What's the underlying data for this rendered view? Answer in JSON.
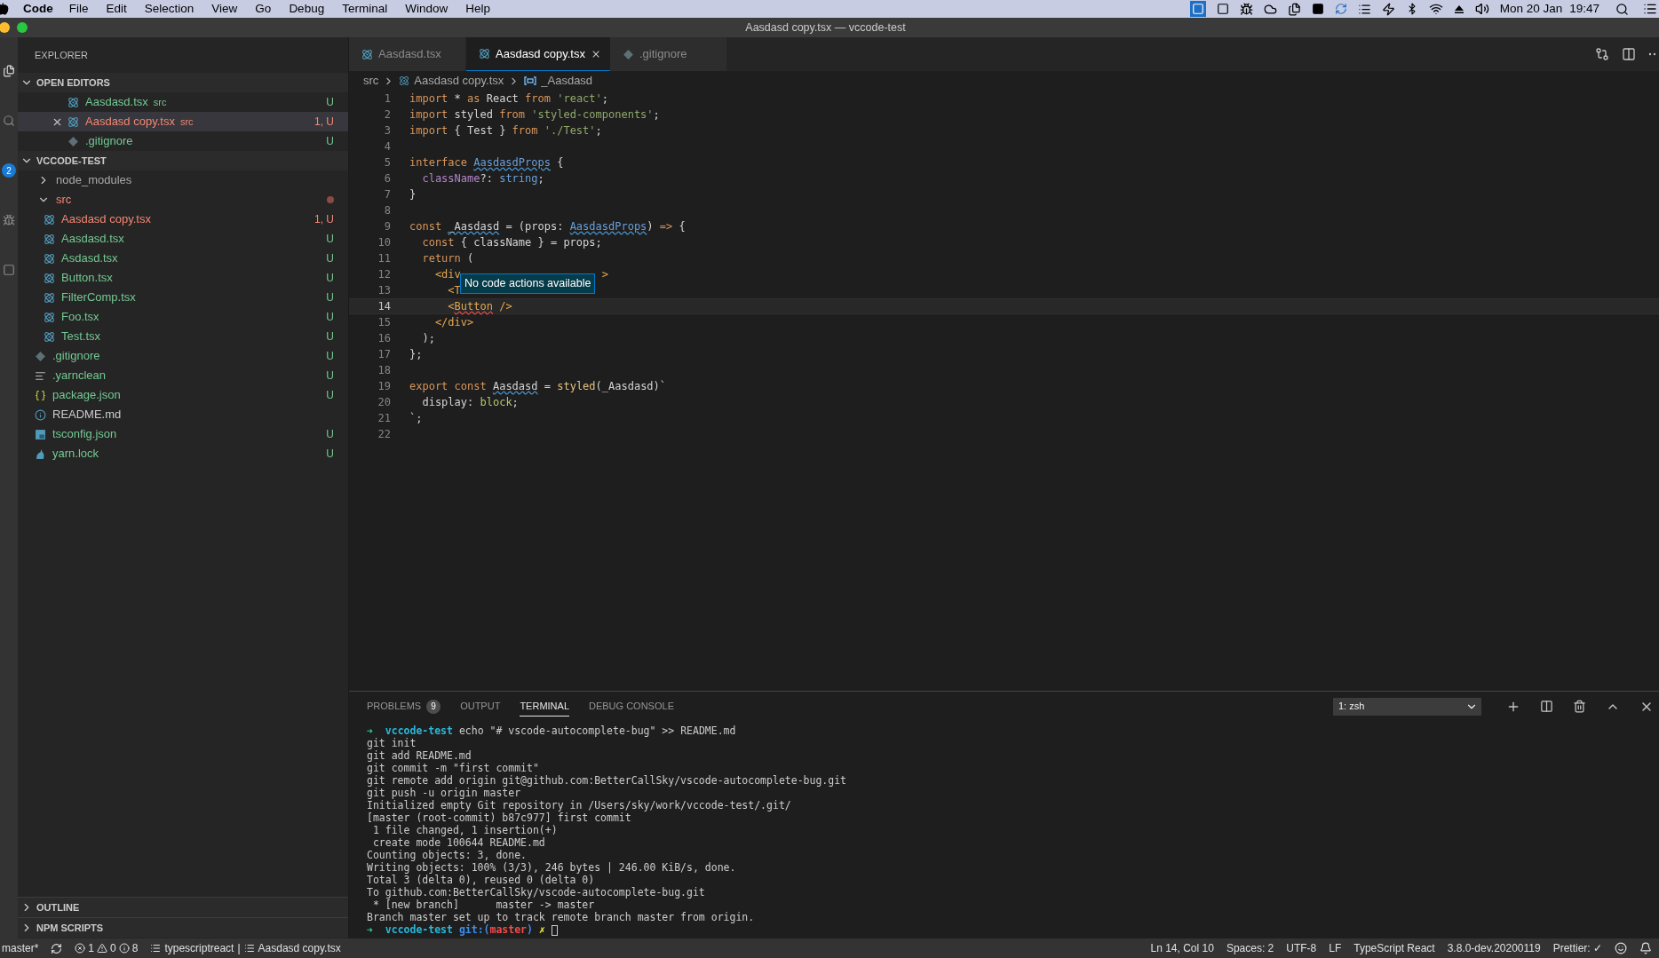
{
  "menu_bar": {
    "app": "Code",
    "menus": [
      "File",
      "Edit",
      "Selection",
      "View",
      "Go",
      "Debug",
      "Terminal",
      "Window",
      "Help"
    ],
    "date": "Mon 20 Jan",
    "time": "19:47"
  },
  "window": {
    "title": "Aasdasd copy.tsx — vccode-test"
  },
  "activity_bar": {
    "badge": "2"
  },
  "sidebar": {
    "title": "EXPLORER",
    "open_editors": {
      "label": "OPEN EDITORS",
      "expanded": true,
      "items": [
        {
          "name": "Aasdasd.tsx",
          "folder": "src",
          "kind": "react",
          "color": "#73c991",
          "badge": "U",
          "selected": false
        },
        {
          "name": "Aasdasd copy.tsx",
          "folder": "src",
          "kind": "react",
          "color": "#f48771",
          "badge": "1, U",
          "selected": true
        },
        {
          "name": ".gitignore",
          "kind": "git",
          "color": "#73c991",
          "badge": "U",
          "selected": false
        }
      ]
    },
    "project": {
      "label": "VCCODE-TEST",
      "expanded": true,
      "items": [
        {
          "name": "node_modules",
          "kind": "folder",
          "color": "#a8a8a8",
          "expanded": false
        },
        {
          "name": "src",
          "kind": "folder",
          "color": "#f48771",
          "expanded": true,
          "children": [
            {
              "name": "Aasdasd copy.tsx",
              "kind": "react",
              "color": "#f48771",
              "badge": "1, U"
            },
            {
              "name": "Aasdasd.tsx",
              "kind": "react",
              "color": "#73c991",
              "badge": "U"
            },
            {
              "name": "Asdasd.tsx",
              "kind": "react",
              "color": "#73c991",
              "badge": "U"
            },
            {
              "name": "Button.tsx",
              "kind": "react",
              "color": "#73c991",
              "badge": "U"
            },
            {
              "name": "FilterComp.tsx",
              "kind": "react",
              "color": "#73c991",
              "badge": "U"
            },
            {
              "name": "Foo.tsx",
              "kind": "react",
              "color": "#73c991",
              "badge": "U"
            },
            {
              "name": "Test.tsx",
              "kind": "react",
              "color": "#73c991",
              "badge": "U"
            }
          ]
        },
        {
          "name": ".gitignore",
          "kind": "git",
          "color": "#73c991",
          "badge": "U"
        },
        {
          "name": ".yarnclean",
          "kind": "lines",
          "color": "#73c991",
          "badge": "U"
        },
        {
          "name": "package.json",
          "kind": "braces",
          "color": "#73c991",
          "badge": "U"
        },
        {
          "name": "README.md",
          "kind": "info",
          "color": "#cccccc"
        },
        {
          "name": "tsconfig.json",
          "kind": "ts",
          "color": "#73c991",
          "badge": "U"
        },
        {
          "name": "yarn.lock",
          "kind": "yarn",
          "color": "#73c991",
          "badge": "U"
        }
      ]
    },
    "outline": {
      "label": "OUTLINE",
      "expanded": false
    },
    "npm_scripts": {
      "label": "NPM SCRIPTS",
      "expanded": false
    }
  },
  "tabs": [
    {
      "label": "Aasdasd.tsx",
      "kind": "react",
      "selected": false
    },
    {
      "label": "Aasdasd copy.tsx",
      "kind": "react",
      "selected": true
    },
    {
      "label": ".gitignore",
      "kind": "git",
      "selected": false
    }
  ],
  "breadcrumb": [
    "src",
    "Aasdasd copy.tsx",
    "_Aasdasd"
  ],
  "editor": {
    "tooltip": "No code actions available",
    "lines": [
      {
        "number": "1",
        "current": false,
        "tokens": [
          {
            "text": "import",
            "kind": "kw"
          },
          {
            "text": " * ",
            "kind": "plain"
          },
          {
            "text": "as",
            "kind": "kw"
          },
          {
            "text": " React ",
            "kind": "plain"
          },
          {
            "text": "from",
            "kind": "kw"
          },
          {
            "text": " 'react'",
            "kind": "str"
          },
          {
            "text": ";",
            "kind": "plain"
          }
        ]
      },
      {
        "number": "2",
        "current": false,
        "tokens": [
          {
            "text": "import",
            "kind": "kw"
          },
          {
            "text": " styled ",
            "kind": "plain"
          },
          {
            "text": "from",
            "kind": "kw"
          },
          {
            "text": " 'styled-components'",
            "kind": "str"
          },
          {
            "text": ";",
            "kind": "plain"
          }
        ]
      },
      {
        "number": "3",
        "current": false,
        "tokens": [
          {
            "text": "import",
            "kind": "kw"
          },
          {
            "text": " { Test } ",
            "kind": "plain"
          },
          {
            "text": "from",
            "kind": "kw"
          },
          {
            "text": " './Test'",
            "kind": "str"
          },
          {
            "text": ";",
            "kind": "plain"
          }
        ]
      },
      {
        "number": "4",
        "current": false
      },
      {
        "number": "5",
        "current": false,
        "tokens": [
          {
            "text": "interface ",
            "kind": "kw"
          },
          {
            "text": "AasdasdProps",
            "kind": "type_warn"
          },
          {
            "text": " {",
            "kind": "plain"
          }
        ]
      },
      {
        "number": "6",
        "current": false,
        "tokens": [
          {
            "text": "  className",
            "kind": "prop"
          },
          {
            "text": "?: ",
            "kind": "plain"
          },
          {
            "text": "string",
            "kind": "type"
          },
          {
            "text": ";",
            "kind": "plain"
          }
        ]
      },
      {
        "number": "7",
        "current": false,
        "tokens": [
          {
            "text": "}",
            "kind": "plain"
          }
        ]
      },
      {
        "number": "8",
        "current": false
      },
      {
        "number": "9",
        "current": false,
        "tokens": [
          {
            "text": "const ",
            "kind": "kw"
          },
          {
            "text": "_Aasdasd",
            "kind": "plain_warn"
          },
          {
            "text": " = (props: ",
            "kind": "plain"
          },
          {
            "text": "AasdasdProps",
            "kind": "type_warn"
          },
          {
            "text": ") ",
            "kind": "plain"
          },
          {
            "text": "=>",
            "kind": "kw"
          },
          {
            "text": " {",
            "kind": "plain"
          }
        ]
      },
      {
        "number": "10",
        "current": false,
        "tokens": [
          {
            "text": "  const",
            "kind": "kw"
          },
          {
            "text": " { className } = props;",
            "kind": "plain"
          }
        ]
      },
      {
        "number": "11",
        "current": false,
        "tokens": [
          {
            "text": "  return",
            "kind": "kw"
          },
          {
            "text": " (",
            "kind": "plain"
          }
        ]
      },
      {
        "number": "12",
        "current": false,
        "tokens": [
          {
            "text": "    <div",
            "kind": "tag"
          },
          {
            "text": "                      >",
            "kind": "tag"
          }
        ]
      },
      {
        "number": "13",
        "current": false,
        "tokens": [
          {
            "text": "      <T",
            "kind": "tag"
          }
        ]
      },
      {
        "number": "14",
        "current": true,
        "tokens": [
          {
            "text": "      <",
            "kind": "tag"
          },
          {
            "text": "Button",
            "kind": "tag_error"
          },
          {
            "text": " />",
            "kind": "tag"
          }
        ]
      },
      {
        "number": "15",
        "current": false,
        "tokens": [
          {
            "text": "    </div>",
            "kind": "tag"
          }
        ]
      },
      {
        "number": "16",
        "current": false,
        "tokens": [
          {
            "text": "  );",
            "kind": "plain"
          }
        ]
      },
      {
        "number": "17",
        "current": false,
        "tokens": [
          {
            "text": "};",
            "kind": "plain"
          }
        ]
      },
      {
        "number": "18",
        "current": false
      },
      {
        "number": "19",
        "current": false,
        "tokens": [
          {
            "text": "export",
            "kind": "kw"
          },
          {
            "text": " const ",
            "kind": "kw"
          },
          {
            "text": "Aasdasd",
            "kind": "plain_warn"
          },
          {
            "text": " = ",
            "kind": "plain"
          },
          {
            "text": "styled",
            "kind": "fn"
          },
          {
            "text": "(_Aasdasd)`",
            "kind": "plain"
          }
        ]
      },
      {
        "number": "20",
        "current": false,
        "tokens": [
          {
            "text": "  display: ",
            "kind": "plain"
          },
          {
            "text": "block",
            "kind": "val"
          },
          {
            "text": ";",
            "kind": "plain"
          }
        ]
      },
      {
        "number": "21",
        "current": false,
        "tokens": [
          {
            "text": "`;",
            "kind": "plain"
          }
        ]
      },
      {
        "number": "22",
        "current": false
      }
    ]
  },
  "panel": {
    "tabs": [
      {
        "label": "PROBLEMS",
        "badge": "9",
        "selected": false
      },
      {
        "label": "OUTPUT",
        "selected": false
      },
      {
        "label": "TERMINAL",
        "selected": true
      },
      {
        "label": "DEBUG CONSOLE",
        "selected": false
      }
    ],
    "terminal_select": "1: zsh",
    "terminal_lines": [
      [
        {
          "text": "➜",
          "kind": "arrow"
        },
        {
          "text": "  vccode-test",
          "kind": "dir"
        },
        {
          "text": " echo \"# vscode-autocomplete-bug\" >> README.md",
          "kind": "plain"
        }
      ],
      [
        {
          "text": "git init",
          "kind": "plain"
        }
      ],
      [
        {
          "text": "git add README.md",
          "kind": "plain"
        }
      ],
      [
        {
          "text": "git commit -m \"first commit\"",
          "kind": "plain"
        }
      ],
      [
        {
          "text": "git remote add origin git@github.com:BetterCallSky/vscode-autocomplete-bug.git",
          "kind": "plain"
        }
      ],
      [
        {
          "text": "git push -u origin master",
          "kind": "plain"
        }
      ],
      [
        {
          "text": "Initialized empty Git repository in /Users/sky/work/vccode-test/.git/",
          "kind": "plain"
        }
      ],
      [
        {
          "text": "[master (root-commit) b87c977] first commit",
          "kind": "plain"
        }
      ],
      [
        {
          "text": " 1 file changed, 1 insertion(+)",
          "kind": "plain"
        }
      ],
      [
        {
          "text": " create mode 100644 README.md",
          "kind": "plain"
        }
      ],
      [
        {
          "text": "Counting objects: 3, done.",
          "kind": "plain"
        }
      ],
      [
        {
          "text": "Writing objects: 100% (3/3), 246 bytes | 246.00 KiB/s, done.",
          "kind": "plain"
        }
      ],
      [
        {
          "text": "Total 3 (delta 0), reused 0 (delta 0)",
          "kind": "plain"
        }
      ],
      [
        {
          "text": "To github.com:BetterCallSky/vscode-autocomplete-bug.git",
          "kind": "plain"
        }
      ],
      [
        {
          "text": " * [new branch]      master -> master",
          "kind": "plain"
        }
      ],
      [
        {
          "text": "Branch master set up to track remote branch master from origin.",
          "kind": "plain"
        }
      ],
      [
        {
          "text": "➜",
          "kind": "arrow"
        },
        {
          "text": "  vccode-test",
          "kind": "dir"
        },
        {
          "text": " git:(",
          "kind": "git"
        },
        {
          "text": "master",
          "kind": "branch"
        },
        {
          "text": ")",
          "kind": "git"
        },
        {
          "text": " ✗",
          "kind": "dirty"
        },
        {
          "kind": "cursor"
        }
      ]
    ]
  },
  "status_bar": {
    "branch": "master*",
    "errors": "1",
    "warnings": "0",
    "infos": "8",
    "language_id": "typescriptreact",
    "separator": "|",
    "file": "Aasdasd copy.tsx",
    "right": [
      "Ln 14, Col 10",
      "Spaces: 2",
      "UTF-8",
      "LF",
      "TypeScript React",
      "3.8.0-dev.20200119",
      "Prettier: ✓"
    ]
  }
}
